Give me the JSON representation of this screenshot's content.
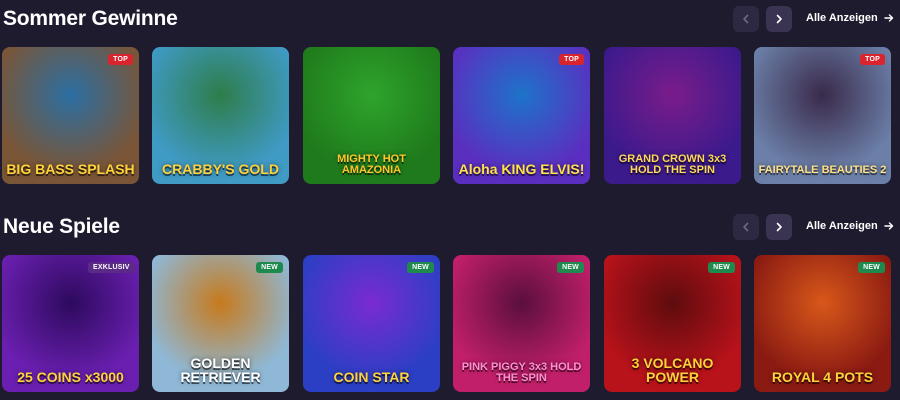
{
  "sections": [
    {
      "title": "Sommer Gewinne",
      "see_all": "Alle Anzeigen",
      "tiles": [
        {
          "name": "BIG BASS SPLASH",
          "badge": "TOP",
          "badge_type": "top",
          "bg": "#7a5536",
          "bg2": "#2b6fa3",
          "text_color": "#ffd23b"
        },
        {
          "name": "CRABBY'S GOLD",
          "badge": "",
          "badge_type": "",
          "bg": "#3f9ac4",
          "bg2": "#2e7d4a",
          "text_color": "#ffcf3a"
        },
        {
          "name": "MIGHTY HOT AMAZONIA",
          "badge": "",
          "badge_type": "",
          "bg": "#1f7a1c",
          "bg2": "#2ea42b",
          "text_color": "#ffc62b"
        },
        {
          "name": "Aloha KING ELVIS!",
          "badge": "TOP",
          "badge_type": "top",
          "bg": "#5a2fc0",
          "bg2": "#1d73c9",
          "text_color": "#ffe14a"
        },
        {
          "name": "GRAND CROWN 3x3 HOLD THE SPIN",
          "badge": "",
          "badge_type": "",
          "bg": "#3b1a8c",
          "bg2": "#7a1c8a",
          "text_color": "#ffd95a"
        },
        {
          "name": "FAIRYTALE BEAUTIES 2",
          "badge": "TOP",
          "badge_type": "top",
          "bg": "#6b7fa8",
          "bg2": "#3a2a4a",
          "text_color": "#ffe08a"
        }
      ]
    },
    {
      "title": "Neue Spiele",
      "see_all": "Alle Anzeigen",
      "tiles": [
        {
          "name": "25 COINS x3000",
          "badge": "EXKLUSIV",
          "badge_type": "excl",
          "bg": "#6a1fb0",
          "bg2": "#2d0a5e",
          "text_color": "#ffd23b"
        },
        {
          "name": "GOLDEN RETRIEVER",
          "badge": "NEW",
          "badge_type": "new",
          "bg": "#8fb8d6",
          "bg2": "#c77a1c",
          "text_color": "#ffffff"
        },
        {
          "name": "COIN STAR",
          "badge": "NEW",
          "badge_type": "new",
          "bg": "#2a3fc4",
          "bg2": "#7a2bd1",
          "text_color": "#ffd23b"
        },
        {
          "name": "PINK PIGGY 3x3 HOLD THE SPIN",
          "badge": "NEW",
          "badge_type": "new",
          "bg": "#c21f6a",
          "bg2": "#5a0f3e",
          "text_color": "#ff8fd0"
        },
        {
          "name": "3 VOLCANO POWER",
          "badge": "NEW",
          "badge_type": "new",
          "bg": "#b8121a",
          "bg2": "#5e0c0e",
          "text_color": "#ffd23b"
        },
        {
          "name": "ROYAL 4 POTS",
          "badge": "NEW",
          "badge_type": "new",
          "bg": "#8a1a12",
          "bg2": "#d8581a",
          "text_color": "#ffd23b"
        }
      ]
    }
  ]
}
